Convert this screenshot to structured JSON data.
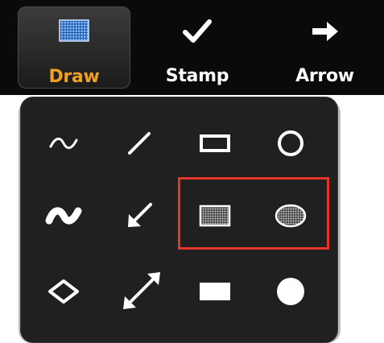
{
  "toolbar": {
    "draw": {
      "label": "Draw",
      "icon": "draw-grid-icon",
      "selected": true
    },
    "stamp": {
      "label": "Stamp",
      "icon": "checkmark-icon"
    },
    "arrow": {
      "label": "Arrow",
      "icon": "right-arrow-icon"
    }
  },
  "draw_panel": {
    "rows": [
      [
        "freehand-thin-icon",
        "line-icon",
        "rectangle-outline-icon",
        "ellipse-outline-icon"
      ],
      [
        "freehand-thick-icon",
        "arrow-line-icon",
        "rectangle-semi-transparent-icon",
        "ellipse-semi-transparent-icon"
      ],
      [
        "diamond-outline-icon",
        "double-arrow-line-icon",
        "rectangle-filled-icon",
        "ellipse-filled-icon"
      ]
    ],
    "highlighted": [
      "rectangle-semi-transparent-icon",
      "ellipse-semi-transparent-icon"
    ]
  },
  "colors": {
    "toolbar_bg": "#0a0a0a",
    "panel_bg": "#202020",
    "selected_label": "#f0a020",
    "highlight": "#e8342b",
    "icon": "#ffffff"
  }
}
